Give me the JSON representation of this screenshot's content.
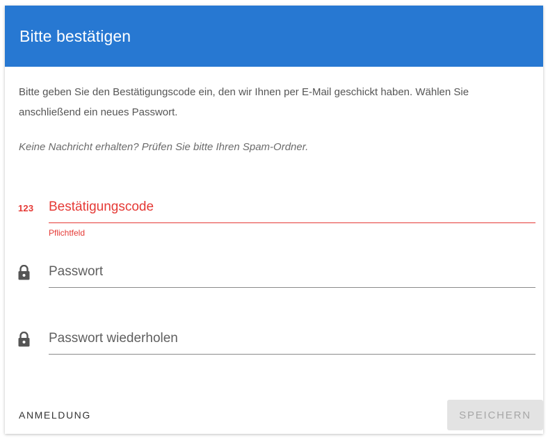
{
  "dialog": {
    "title": "Bitte bestätigen",
    "instruction": "Bitte geben Sie den Bestätigungscode ein, den wir Ihnen per E-Mail geschickt haben. Wählen Sie anschließend ein neues Passwort.",
    "hint": "Keine Nachricht erhalten? Prüfen Sie bitte Ihren Spam-Ordner.",
    "header_color": "#2778d2",
    "error_color": "#e53935"
  },
  "form": {
    "code_icon_text": "123",
    "code_placeholder": "Bestätigungscode",
    "code_error": "Pflichtfeld",
    "password_placeholder": "Passwort",
    "password_repeat_placeholder": "Passwort wiederholen",
    "password_icon": "lock-icon"
  },
  "footer": {
    "login_label": "ANMELDUNG",
    "save_label": "SPEICHERN"
  }
}
